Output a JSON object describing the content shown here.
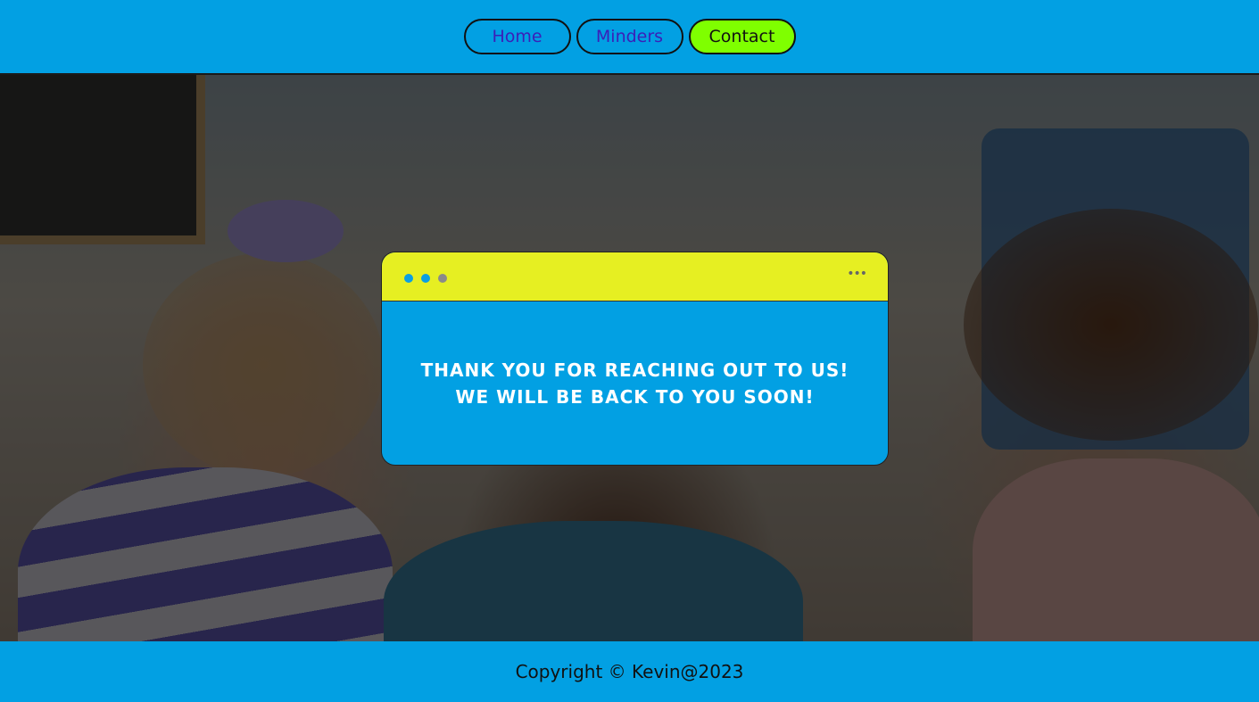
{
  "nav": {
    "items": [
      {
        "label": "Home",
        "active": false
      },
      {
        "label": "Minders",
        "active": false
      },
      {
        "label": "Contact",
        "active": true
      }
    ]
  },
  "dialog": {
    "window_dots": [
      {
        "icon": "dot-blue",
        "color": "#0b9fe2"
      },
      {
        "icon": "dot-blue",
        "color": "#0b9fe2"
      },
      {
        "icon": "dot-gray",
        "color": "#8a8a8a"
      }
    ],
    "menu_icon": "more-horizontal-icon",
    "line1": "THANK YOU FOR REACHING OUT TO US!",
    "line2": "WE WILL BE BACK TO YOU SOON!"
  },
  "footer": {
    "copyright": "Copyright © Kevin@2023"
  },
  "colors": {
    "brand_blue": "#02a0e3",
    "active_nav": "#7fff00",
    "dialog_header": "#e6ef22",
    "nav_text": "#3b1fb8"
  }
}
